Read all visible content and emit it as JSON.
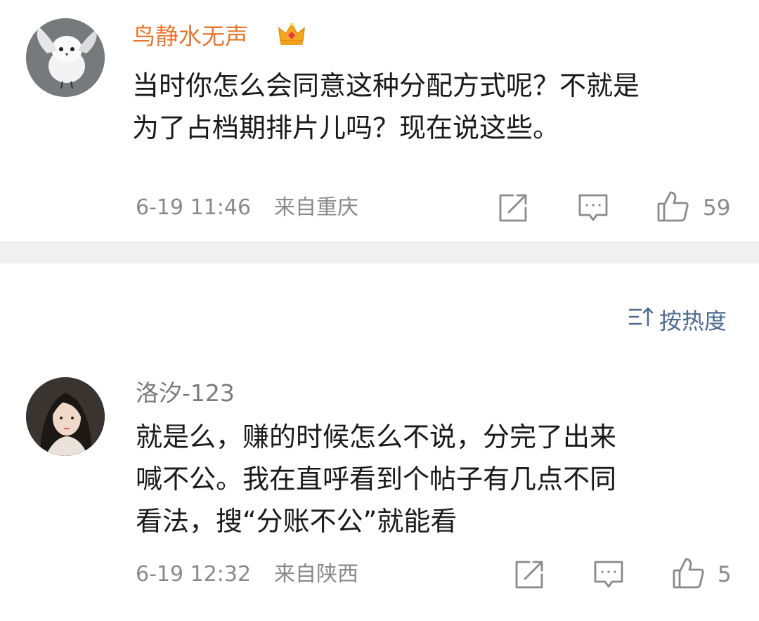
{
  "comments": [
    {
      "username": "鸟静水无声",
      "username_color": "#e8772e",
      "badge": "crown-icon",
      "lines": [
        "当时你怎么会同意这种分配方式呢？不就是",
        "为了占档期排片儿吗？现在说这些。"
      ],
      "time": "6-19 11:46",
      "location": "来自重庆",
      "likes": "59"
    },
    {
      "username": "洛汐-123",
      "username_color": "#7a7a7a",
      "lines": [
        "就是么，赚的时候怎么不说，分完了出来",
        "喊不公。我在直呼看到个帖子有几点不同",
        "看法，搜“分账不公”就能看"
      ],
      "time": "6-19 12:32",
      "location": "来自陕西",
      "likes": "5"
    }
  ],
  "sort": {
    "label": "按热度",
    "icon": "sort-icon",
    "color": "#4e6c8f"
  },
  "colors": {
    "meta": "#8a8a8a",
    "divider": "#f0f0f0",
    "text": "#1a1a1a"
  }
}
